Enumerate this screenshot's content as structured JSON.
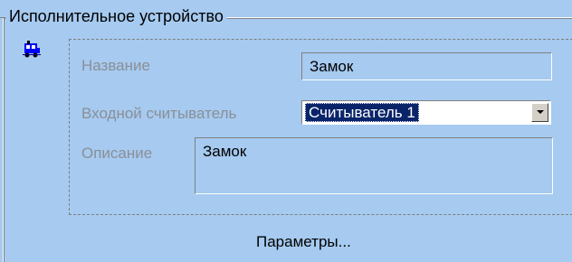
{
  "group": {
    "title": "Исполнительное устройство"
  },
  "icons": {
    "device": "train-icon"
  },
  "form": {
    "name_label": "Название",
    "name_value": "Замок",
    "reader_label": "Входной считыватель",
    "reader_value": "Считыватель 1",
    "description_label": "Описание",
    "description_value": "Замок"
  },
  "buttons": {
    "params_label": "Параметры..."
  },
  "colors": {
    "background": "#a6caf0",
    "selection": "#0a246a"
  }
}
